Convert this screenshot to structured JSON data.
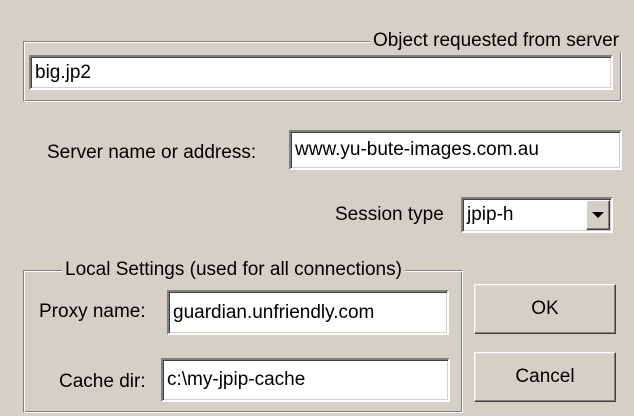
{
  "object_group": {
    "caption": "Object requested from server",
    "object_value": "big.jp2"
  },
  "server": {
    "label": "Server name or address:",
    "value": "www.yu-bute-images.com.au"
  },
  "session": {
    "label": "Session type",
    "selected": "jpip-h",
    "icon": "chevron-down-icon"
  },
  "local_settings": {
    "caption": "Local Settings (used for all connections)",
    "proxy_label": "Proxy name:",
    "proxy_value": "guardian.unfriendly.com",
    "cache_label": "Cache dir:",
    "cache_value": "c:\\my-jpip-cache"
  },
  "buttons": {
    "ok_label": "OK",
    "cancel_label": "Cancel"
  }
}
